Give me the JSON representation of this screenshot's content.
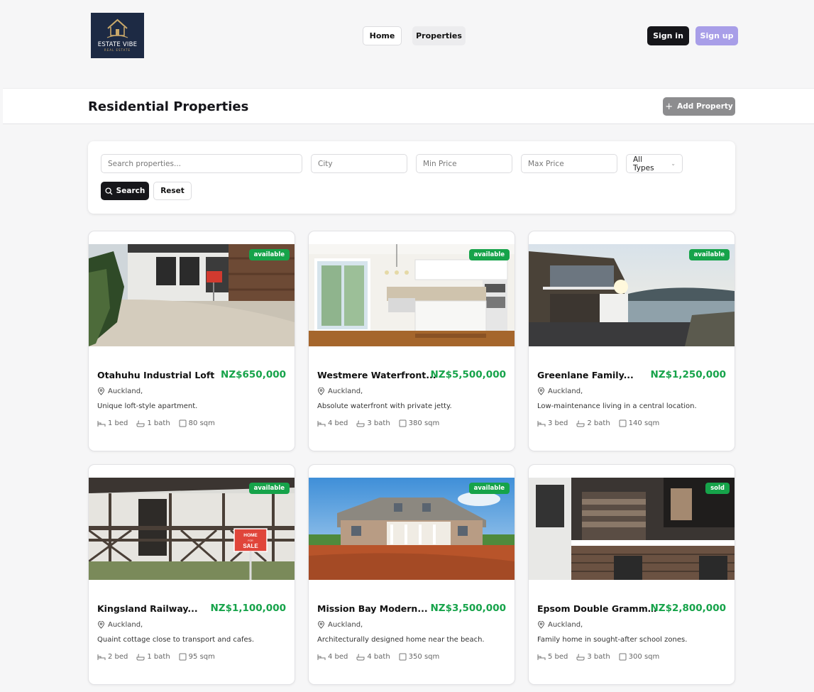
{
  "header": {
    "logo_text": "ESTATE VIBE",
    "logo_subtext": "REAL ESTATE",
    "nav": [
      {
        "label": "Home"
      },
      {
        "label": "Properties"
      }
    ],
    "signin_label": "Sign in",
    "signup_label": "Sign up"
  },
  "titlebar": {
    "title": "Residential Properties",
    "add_label": "Add Property"
  },
  "filter": {
    "search_placeholder": "Search properties...",
    "city_placeholder": "City",
    "min_price_placeholder": "Min Price",
    "max_price_placeholder": "Max Price",
    "type_select": "All Types",
    "search_label": "Search",
    "reset_label": "Reset"
  },
  "colors": {
    "accent_green": "#16a34a",
    "signup_purple": "#a89ee8",
    "dark": "#16161a"
  },
  "listings": [
    {
      "status": "available",
      "title": "Otahuhu Industrial Loft",
      "price": "NZ$650,000",
      "location": "Auckland,",
      "description": "Unique loft-style apartment.",
      "beds": "1 bed",
      "baths": "1 bath",
      "area": "80 sqm"
    },
    {
      "status": "available",
      "title": "Westmere Waterfront...",
      "price": "NZ$5,500,000",
      "location": "Auckland,",
      "description": "Absolute waterfront with private jetty.",
      "beds": "4 bed",
      "baths": "3 bath",
      "area": "380 sqm"
    },
    {
      "status": "available",
      "title": "Greenlane Family...",
      "price": "NZ$1,250,000",
      "location": "Auckland,",
      "description": "Low-maintenance living in a central location.",
      "beds": "3 bed",
      "baths": "2 bath",
      "area": "140 sqm"
    },
    {
      "status": "available",
      "title": "Kingsland Railway...",
      "price": "NZ$1,100,000",
      "location": "Auckland,",
      "description": "Quaint cottage close to transport and cafes.",
      "beds": "2 bed",
      "baths": "1 bath",
      "area": "95 sqm",
      "sign_text": [
        "HOME",
        "FOR",
        "SALE"
      ]
    },
    {
      "status": "available",
      "title": "Mission Bay Modern...",
      "price": "NZ$3,500,000",
      "location": "Auckland,",
      "description": "Architecturally designed home near the beach.",
      "beds": "4 bed",
      "baths": "4 bath",
      "area": "350 sqm"
    },
    {
      "status": "sold",
      "title": "Epsom Double Grammar...",
      "price": "NZ$2,800,000",
      "location": "Auckland,",
      "description": "Family home in sought-after school zones.",
      "beds": "5 bed",
      "baths": "3 bath",
      "area": "300 sqm"
    }
  ]
}
